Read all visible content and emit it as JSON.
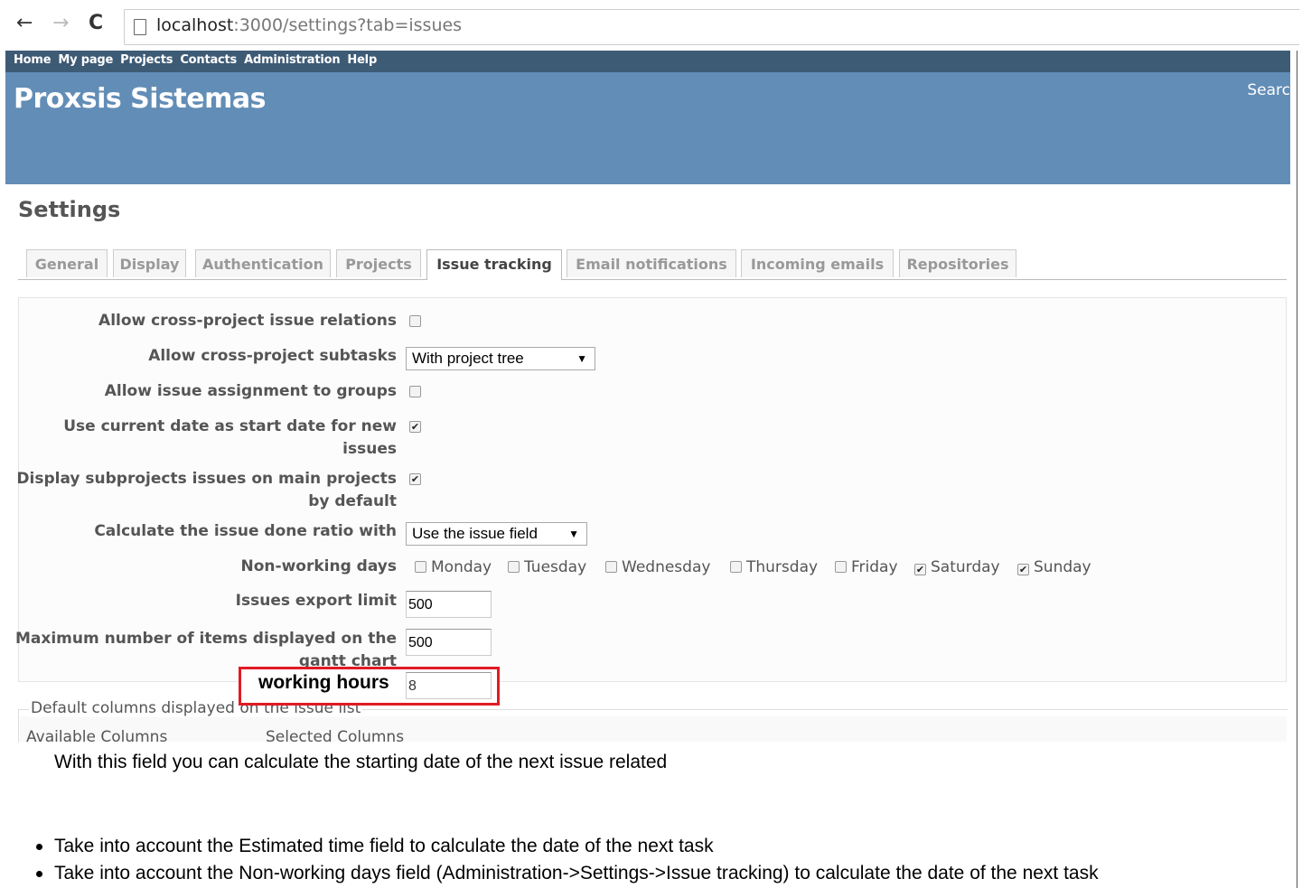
{
  "browser": {
    "back_icon": "←",
    "forward_icon": "→",
    "reload_icon": "C",
    "url_host": "localhost",
    "url_rest": ":3000/settings?tab=issues"
  },
  "top_menu": [
    "Home",
    "My page",
    "Projects",
    "Contacts",
    "Administration",
    "Help"
  ],
  "header": {
    "title": "Proxsis Sistemas",
    "search_label": "Searc"
  },
  "page_title": "Settings",
  "tabs": [
    "General",
    "Display",
    "Authentication",
    "Projects",
    "Issue tracking",
    "Email notifications",
    "Incoming emails",
    "Repositories"
  ],
  "selected_tab": "Issue tracking",
  "settings": {
    "cross_project_relations": {
      "label": "Allow cross-project issue relations",
      "checked": false
    },
    "cross_project_subtasks": {
      "label": "Allow cross-project subtasks",
      "value": "With project tree"
    },
    "assignment_to_groups": {
      "label": "Allow issue assignment to groups",
      "checked": false
    },
    "current_date_start": {
      "label_line1": "Use current date as start date for new",
      "label_line2": "issues",
      "checked": true
    },
    "display_subprojects": {
      "label_line1": "Display subprojects issues on main projects",
      "label_line2": "by default",
      "checked": true
    },
    "done_ratio": {
      "label": "Calculate the issue done ratio with",
      "value": "Use the issue field"
    },
    "non_working_days": {
      "label": "Non-working days",
      "days": [
        {
          "name": "Monday",
          "checked": false
        },
        {
          "name": "Tuesday",
          "checked": false
        },
        {
          "name": "Wednesday",
          "checked": false
        },
        {
          "name": "Thursday",
          "checked": false
        },
        {
          "name": "Friday",
          "checked": false
        },
        {
          "name": "Saturday",
          "checked": true
        },
        {
          "name": "Sunday",
          "checked": true
        }
      ]
    },
    "export_limit": {
      "label": "Issues export limit",
      "value": "500"
    },
    "gantt_items": {
      "label_line1": "Maximum number of items displayed on the",
      "label_line2": "gantt chart",
      "value": "500"
    },
    "working_hours": {
      "label": "working hours",
      "value": "8"
    }
  },
  "columns_fieldset": {
    "legend": "Default columns displayed on the issue list",
    "available": "Available Columns",
    "selected": "Selected Columns"
  },
  "description": "With this field you can calculate the starting date of the next issue related",
  "bullets": [
    "Take into account the Estimated time field to calculate the date of the next task",
    "Take into account the Non-working days field (Administration->Settings->Issue tracking) to calculate the date of the next task"
  ],
  "colors": {
    "top_menu": "#3e5b76",
    "header": "#628db6",
    "highlight": "#e01b24"
  }
}
